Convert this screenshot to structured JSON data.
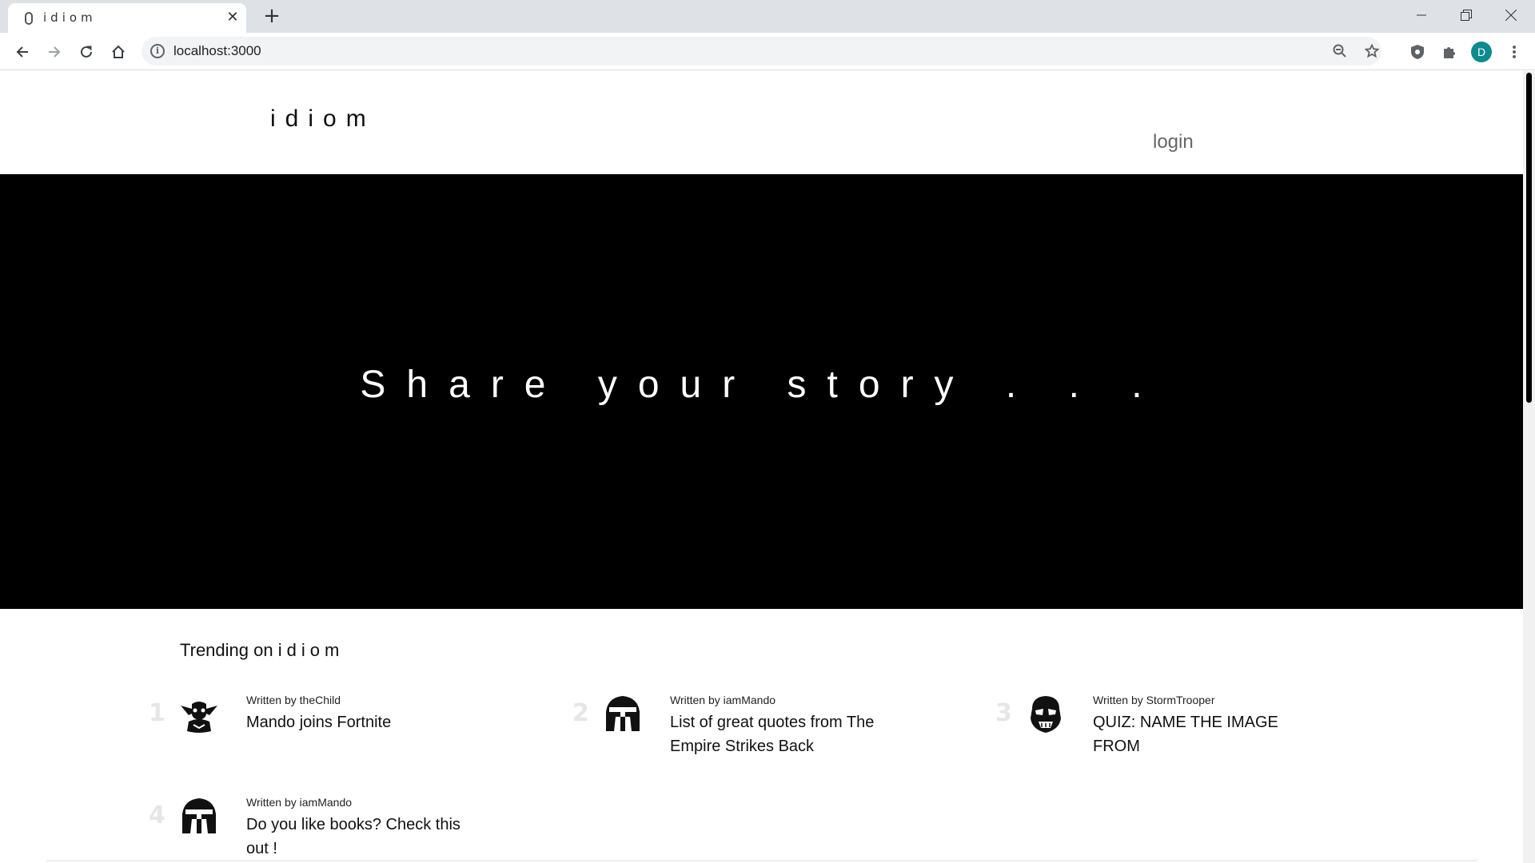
{
  "browser": {
    "tab_title": "idiom",
    "url": "localhost:3000",
    "profile_initial": "D",
    "accent": "#0b8a8f"
  },
  "header": {
    "logo": "idiom",
    "login": "login"
  },
  "hero": {
    "text": "Share your story . . ."
  },
  "trending": {
    "heading_prefix": "Trending on",
    "heading_brand": "idiom",
    "items": [
      {
        "rank": "1",
        "author": "Written by theChild",
        "title": "Mando joins Fortnite",
        "avatar_icon": "yoda-icon"
      },
      {
        "rank": "2",
        "author": "Written by iamMando",
        "title": "List of great quotes from The Empire Strikes Back",
        "avatar_icon": "mandalorian-helmet-icon"
      },
      {
        "rank": "3",
        "author": "Written by StormTrooper",
        "title": "QUIZ: NAME THE IMAGE FROM",
        "avatar_icon": "stormtrooper-helmet-icon"
      },
      {
        "rank": "4",
        "author": "Written by iamMando",
        "title": "Do you like books? Check this out !",
        "avatar_icon": "mandalorian-helmet-icon"
      }
    ]
  }
}
